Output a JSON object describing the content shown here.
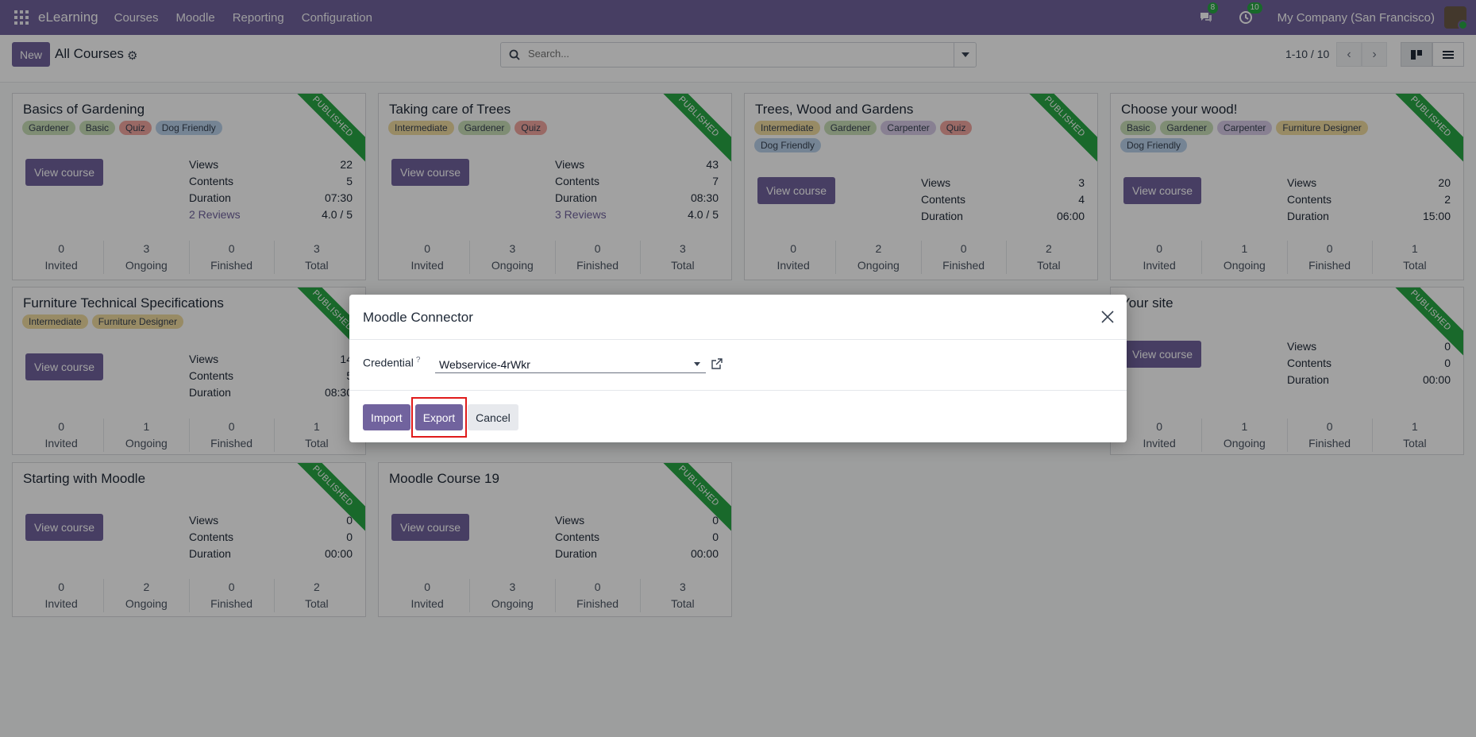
{
  "navbar": {
    "brand": "eLearning",
    "menus": [
      "Courses",
      "Moodle",
      "Reporting",
      "Configuration"
    ],
    "messages_count": "8",
    "activities_count": "10",
    "company": "My Company (San Francisco)"
  },
  "control_panel": {
    "new_label": "New",
    "title": "All Courses",
    "search_placeholder": "Search...",
    "pager": "1-10 / 10"
  },
  "course_labels": {
    "view_course": "View course",
    "views": "Views",
    "contents": "Contents",
    "duration": "Duration",
    "invited": "Invited",
    "ongoing": "Ongoing",
    "finished": "Finished",
    "total": "Total",
    "published": "PUBLISHED"
  },
  "courses": [
    {
      "title": "Basics of Gardening",
      "tags": [
        "Gardener",
        "Basic",
        "Quiz",
        "Dog Friendly"
      ],
      "views": "22",
      "contents": "5",
      "duration": "07:30",
      "reviews": "2 Reviews",
      "rating": "4.0 / 5",
      "invited": "0",
      "ongoing": "3",
      "finished": "0",
      "total": "3"
    },
    {
      "title": "Taking care of Trees",
      "tags": [
        "Intermediate",
        "Gardener",
        "Quiz"
      ],
      "views": "43",
      "contents": "7",
      "duration": "08:30",
      "reviews": "3 Reviews",
      "rating": "4.0 / 5",
      "invited": "0",
      "ongoing": "3",
      "finished": "0",
      "total": "3"
    },
    {
      "title": "Trees, Wood and Gardens",
      "tags": [
        "Intermediate",
        "Gardener",
        "Carpenter",
        "Quiz",
        "Dog Friendly"
      ],
      "views": "3",
      "contents": "4",
      "duration": "06:00",
      "invited": "0",
      "ongoing": "2",
      "finished": "0",
      "total": "2"
    },
    {
      "title": "Choose your wood!",
      "tags": [
        "Basic",
        "Gardener",
        "Carpenter",
        "Furniture Designer",
        "Dog Friendly"
      ],
      "views": "20",
      "contents": "2",
      "duration": "15:00",
      "invited": "0",
      "ongoing": "1",
      "finished": "0",
      "total": "1"
    },
    {
      "title": "Furniture Technical Specifications",
      "tags": [
        "Intermediate",
        "Furniture Designer"
      ],
      "views": "14",
      "contents": "5",
      "duration": "08:30",
      "invited": "0",
      "ongoing": "1",
      "finished": "0",
      "total": "1"
    },
    {
      "title": "Your site",
      "tags": [],
      "views": "0",
      "contents": "0",
      "duration": "00:00",
      "invited": "0",
      "ongoing": "1",
      "finished": "0",
      "total": "1"
    },
    {
      "title": "Starting with Moodle",
      "tags": [],
      "views": "0",
      "contents": "0",
      "duration": "00:00",
      "invited": "0",
      "ongoing": "2",
      "finished": "0",
      "total": "2"
    },
    {
      "title": "Moodle Course 19",
      "tags": [],
      "views": "0",
      "contents": "0",
      "duration": "00:00",
      "invited": "0",
      "ongoing": "3",
      "finished": "0",
      "total": "3"
    }
  ],
  "tag_colors": {
    "Gardener": "#c9dfb8",
    "Basic": "#c9dfb8",
    "Quiz": "#f2a6a0",
    "Dog Friendly": "#b9d2ea",
    "Intermediate": "#f1dca0",
    "Carpenter": "#d7cbe8",
    "Furniture Designer": "#f1dca0"
  },
  "dialog": {
    "title": "Moodle Connector",
    "credential_label": "Credential",
    "help_mark": "?",
    "credential_value": "Webservice-4rWkr",
    "import_label": "Import",
    "export_label": "Export",
    "cancel_label": "Cancel"
  },
  "colors": {
    "primary": "#71639e",
    "published": "#28a745",
    "highlight": "#e01b1b"
  }
}
